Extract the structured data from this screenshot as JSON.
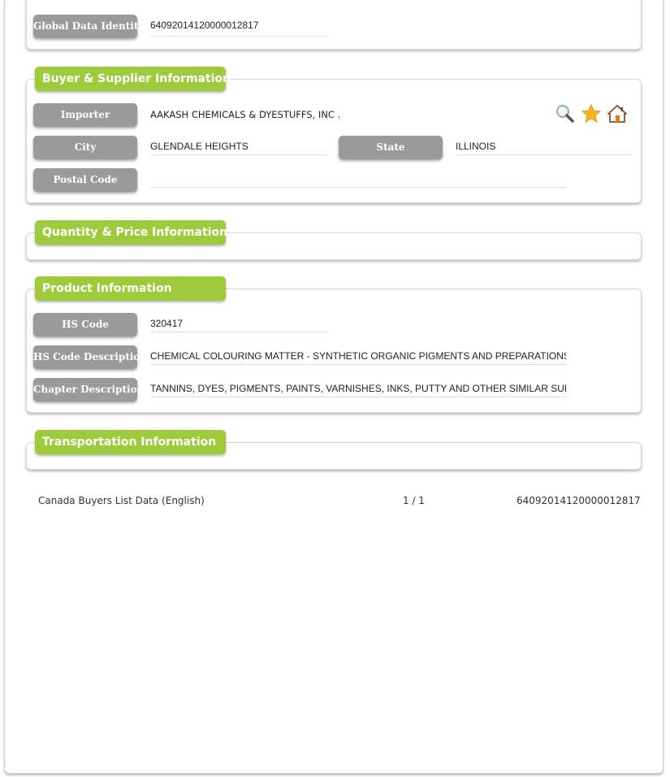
{
  "global_identity": {
    "label": "Global Data Identity",
    "value": "64092014120000012817"
  },
  "buyer_supplier": {
    "title": "Buyer & Supplier Information",
    "importer_label": "Importer",
    "importer_value": "AAKASH CHEMICALS & DYESTUFFS, INC .",
    "city_label": "City",
    "city_value": "GLENDALE HEIGHTS",
    "state_label": "State",
    "state_value": "ILLINOIS",
    "postal_label": "Postal Code",
    "postal_value": "",
    "actions": [
      {
        "name": "search",
        "icon": "magnifier-icon"
      },
      {
        "name": "favorite",
        "icon": "star-icon"
      },
      {
        "name": "home",
        "icon": "home-icon"
      }
    ]
  },
  "quantity_price": {
    "title": "Quantity & Price Information"
  },
  "product": {
    "title": "Product Information",
    "hs_code_label": "HS Code",
    "hs_code_value": "320417",
    "hs_desc_label": "HS Code Description",
    "hs_desc_value": "CHEMICAL COLOURING MATTER - SYNTHETIC ORGANIC PIGMENTS AND PREPARATIONS",
    "chapter_label": "Chapter Description",
    "chapter_value": "TANNINS, DYES, PIGMENTS, PAINTS, VARNISHES, INKS, PUTTY AND OTHER SIMILAR SUBSTANCES"
  },
  "transportation": {
    "title": "Transportation Information"
  },
  "footer": {
    "source": "Canada Buyers List Data (English)",
    "page": "1 / 1",
    "identity": "64092014120000012817"
  },
  "colors": {
    "section_header": "#9dcb3b",
    "label_bg": "#9a9a9a"
  }
}
